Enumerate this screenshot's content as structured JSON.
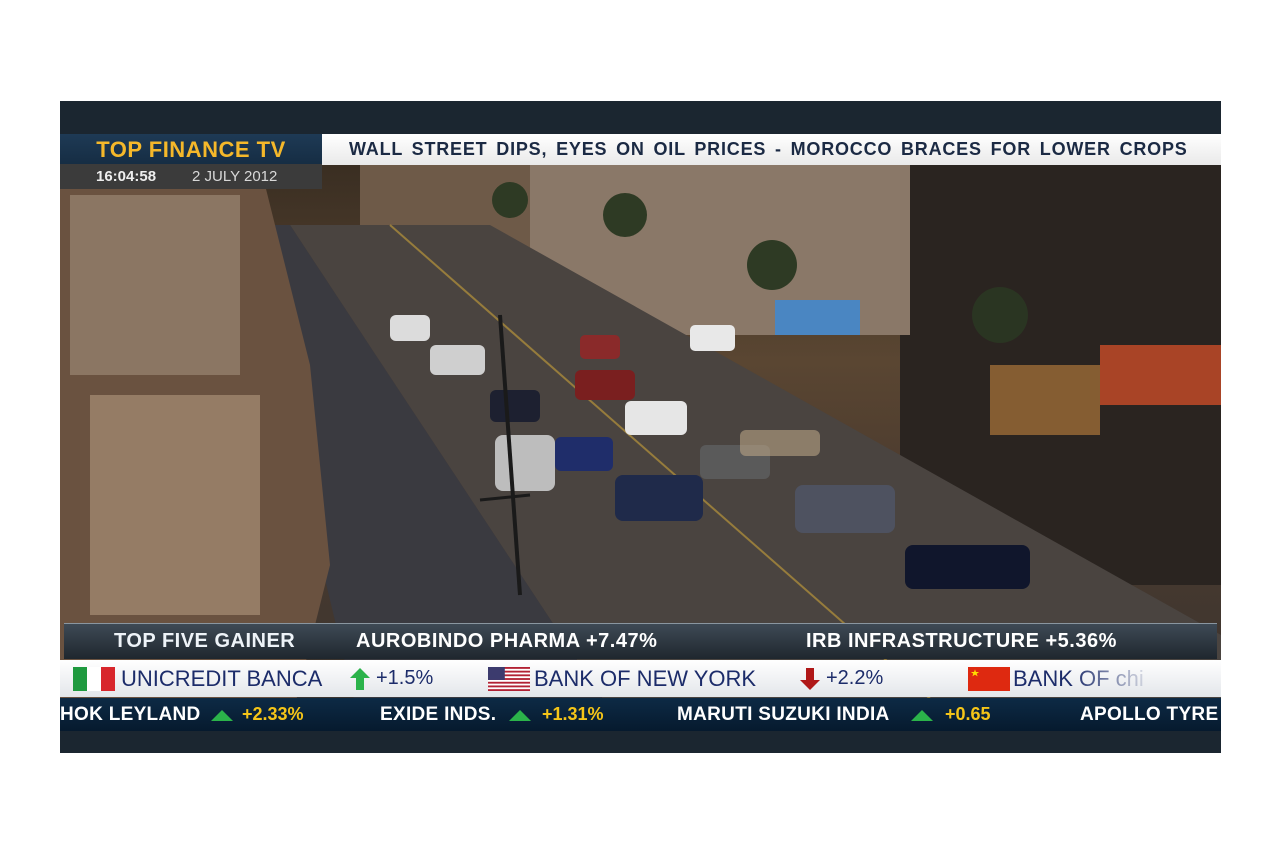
{
  "channel": {
    "name": "TOP FINANCE TV",
    "time": "16:04:58",
    "date": "2 JULY 2012"
  },
  "headline_ticker": {
    "text": "WALL STREET DIPS, EYES ON OIL PRICES  -  MOROCCO BRACES FOR LOWER CROPS"
  },
  "gainers": {
    "title": "TOP FIVE GAINER",
    "items": [
      {
        "text": "AUROBINDO PHARMA +7.47%"
      },
      {
        "text": "IRB INFRASTRUCTURE +5.36%"
      }
    ]
  },
  "intl_ticker": {
    "items": [
      {
        "flag": "italy-flag",
        "name": "UNICREDIT  BANCA",
        "direction": "up",
        "change": "+1.5%"
      },
      {
        "flag": "usa-flag",
        "name": "BANK  OF  NEW  YORK",
        "direction": "down",
        "change": "+2.2%"
      },
      {
        "flag": "china-flag",
        "name": "BANK  OF  chi",
        "direction": "",
        "change": ""
      }
    ]
  },
  "nse_ticker": {
    "items": [
      {
        "name": "HOK  LEYLAND",
        "change": "+2.33%"
      },
      {
        "name": "EXIDE  INDS.",
        "change": "+1.31%"
      },
      {
        "name": "MARUTI  SUZUKI  INDIA",
        "change": "+0.65"
      },
      {
        "name": "APOLLO  TYRE",
        "change": ""
      }
    ]
  },
  "colors": {
    "brand": "#f5b82a",
    "ticker_text": "#1c2c6a",
    "up": "#2bb34a",
    "down": "#b01818",
    "value": "#f5c518"
  }
}
